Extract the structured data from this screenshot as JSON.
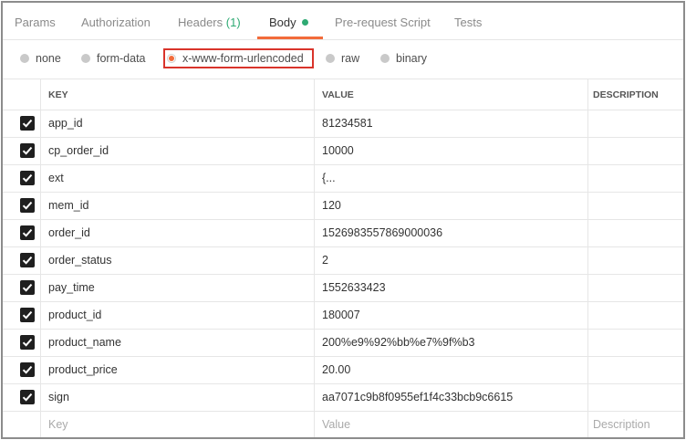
{
  "tabs": [
    {
      "label": "Params"
    },
    {
      "label": "Authorization"
    },
    {
      "label": "Headers",
      "count": "(1)"
    },
    {
      "label": "Body",
      "active": true
    },
    {
      "label": "Pre-request Script"
    },
    {
      "label": "Tests"
    }
  ],
  "body_modes": [
    {
      "label": "none"
    },
    {
      "label": "form-data"
    },
    {
      "label": "x-www-form-urlencoded",
      "selected": true
    },
    {
      "label": "raw"
    },
    {
      "label": "binary"
    }
  ],
  "table": {
    "headers": {
      "key": "KEY",
      "value": "VALUE",
      "description": "DESCRIPTION"
    },
    "rows": [
      {
        "key": "app_id",
        "value": "81234581",
        "checked": true
      },
      {
        "key": "cp_order_id",
        "value": "10000",
        "checked": true
      },
      {
        "key": "ext",
        "value": "{...",
        "checked": true
      },
      {
        "key": "mem_id",
        "value": "120",
        "checked": true
      },
      {
        "key": "order_id",
        "value": "1526983557869000036",
        "checked": true
      },
      {
        "key": "order_status",
        "value": "2",
        "checked": true
      },
      {
        "key": "pay_time",
        "value": "1552633423",
        "checked": true
      },
      {
        "key": "product_id",
        "value": "180007",
        "checked": true
      },
      {
        "key": "product_name",
        "value": "200%e9%92%bb%e7%9f%b3",
        "checked": true
      },
      {
        "key": "product_price",
        "value": "20.00",
        "checked": true
      },
      {
        "key": "sign",
        "value": "aa7071c9b8f0955ef1f4c33bcb9c6615",
        "checked": true
      }
    ],
    "new_row": {
      "key": "Key",
      "value": "Value",
      "description": "Description"
    }
  },
  "colors": {
    "accent": "#f26b3a",
    "status_green": "#2eaa73",
    "highlight_red": "#d9342b"
  }
}
